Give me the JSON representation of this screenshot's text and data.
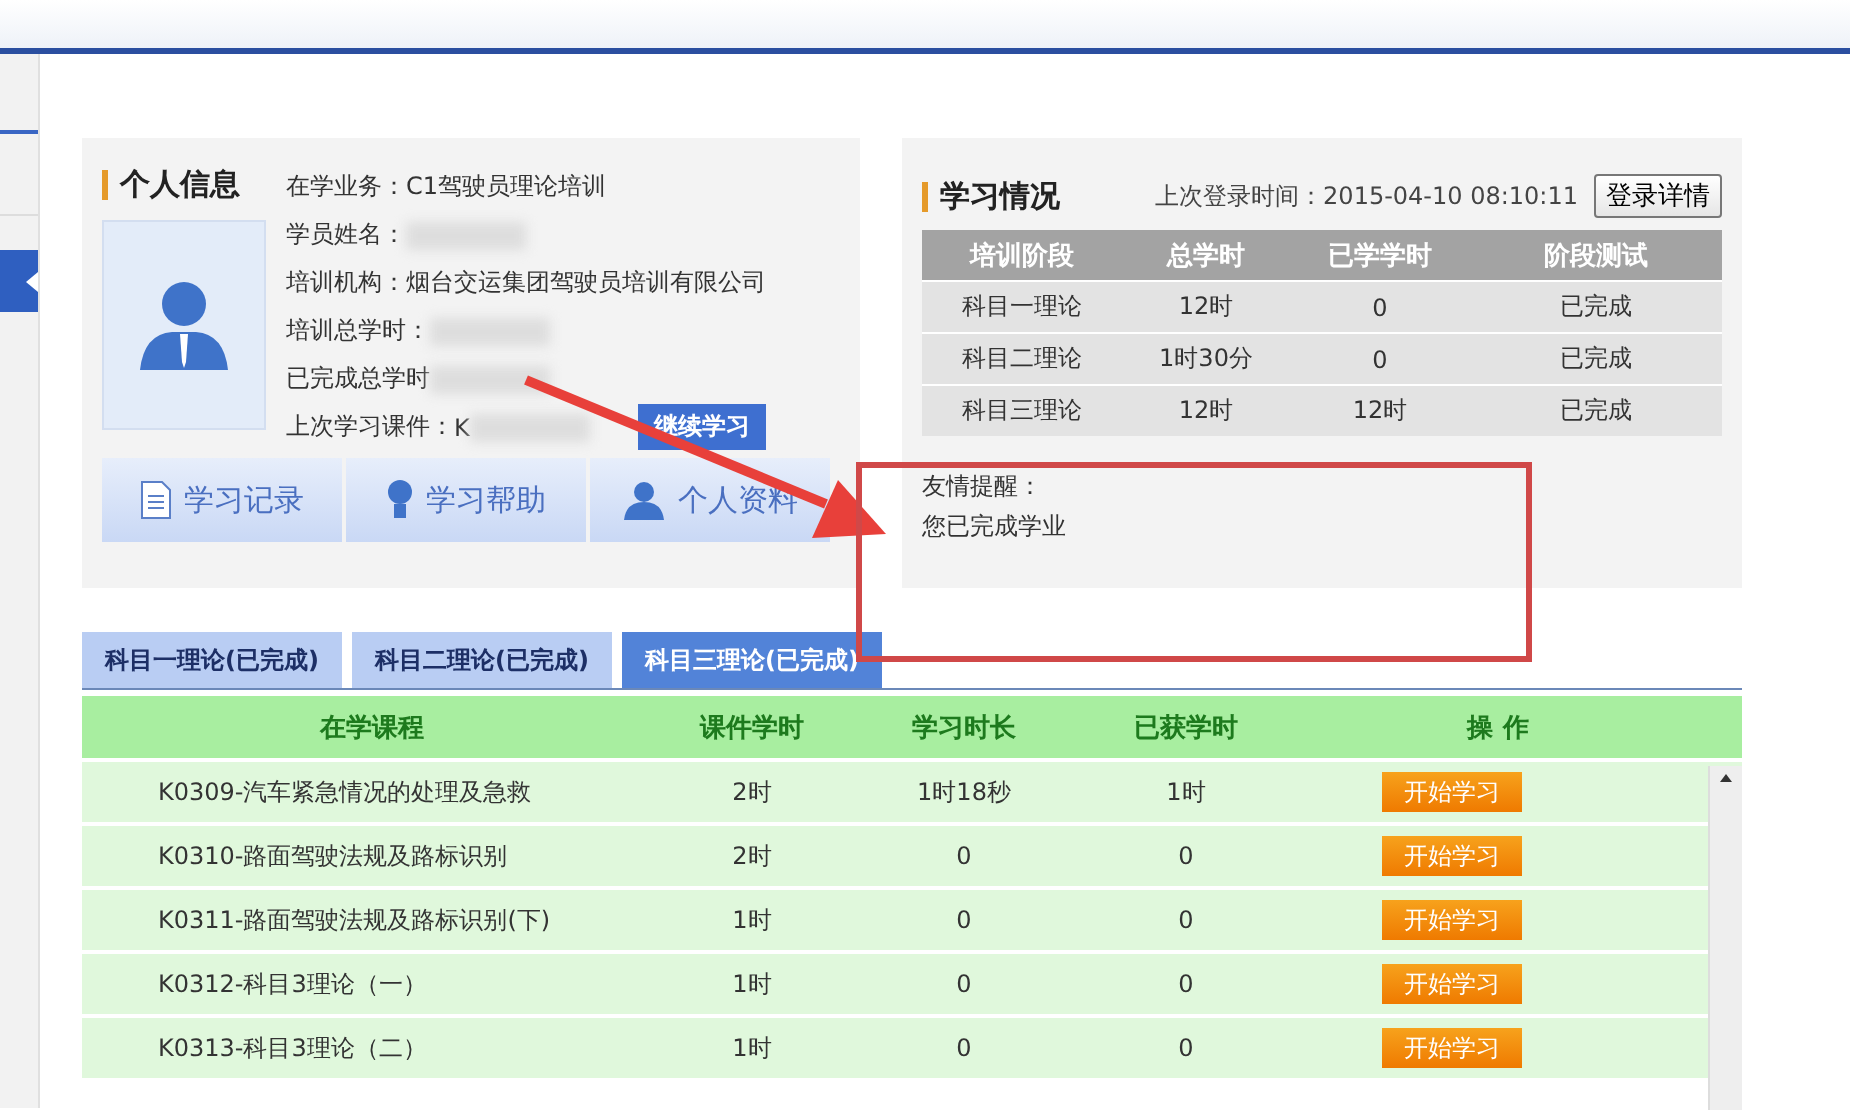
{
  "personal_info": {
    "title": "个人信息",
    "fields": [
      {
        "label": "在学业务：",
        "value": "C1驾驶员理论培训",
        "redacted": false
      },
      {
        "label": "学员姓名：",
        "redacted": true
      },
      {
        "label": "培训机构：",
        "value": "烟台交运集团驾驶员培训有限公司",
        "redacted": false
      },
      {
        "label": "培训总学时：",
        "redacted": true
      },
      {
        "label": "已完成总学时",
        "redacted": true
      },
      {
        "label": "上次学习课件：",
        "value": "K",
        "redacted": true
      }
    ],
    "continue_button": "继续学习",
    "shortcuts": [
      {
        "label": "学习记录",
        "kind": "document"
      },
      {
        "label": "学习帮助",
        "kind": "bulb"
      },
      {
        "label": "个人资料",
        "kind": "person"
      }
    ]
  },
  "study_status": {
    "title": "学习情况",
    "last_login": "上次登录时间：2015-04-10 08:10:11",
    "details_button": "登录详情",
    "columns": [
      "培训阶段",
      "总学时",
      "已学学时",
      "阶段测试"
    ],
    "rows": [
      [
        "科目一理论",
        "12时",
        "0",
        "已完成"
      ],
      [
        "科目二理论",
        "1时30分",
        "0",
        "已完成"
      ],
      [
        "科目三理论",
        "12时",
        "12时",
        "已完成"
      ]
    ],
    "reminder_title": "友情提醒：",
    "reminder": "您已完成学业"
  },
  "stage_tabs": [
    {
      "label": "科目一理论(已完成)",
      "selected": false
    },
    {
      "label": "科目二理论(已完成)",
      "selected": false
    },
    {
      "label": "科目三理论(已完成)",
      "selected": true
    }
  ],
  "courses": {
    "columns": [
      "在学课程",
      "课件学时",
      "学习时长",
      "已获学时",
      "操 作"
    ],
    "rows": [
      {
        "course": "K0309-汽车紧急情况的处理及急救",
        "hours": "2时",
        "duration": "1时18秒",
        "earned": "1时",
        "action": "开始学习"
      },
      {
        "course": "K0310-路面驾驶法规及路标识别",
        "hours": "2时",
        "duration": "0",
        "earned": "0",
        "action": "开始学习"
      },
      {
        "course": "K0311-路面驾驶法规及路标识别(下)",
        "hours": "1时",
        "duration": "0",
        "earned": "0",
        "action": "开始学习"
      },
      {
        "course": "K0312-科目3理论（一）",
        "hours": "1时",
        "duration": "0",
        "earned": "0",
        "action": "开始学习"
      },
      {
        "course": "K0313-科目3理论（二）",
        "hours": "1时",
        "duration": "0",
        "earned": "0",
        "action": "开始学习"
      }
    ]
  }
}
